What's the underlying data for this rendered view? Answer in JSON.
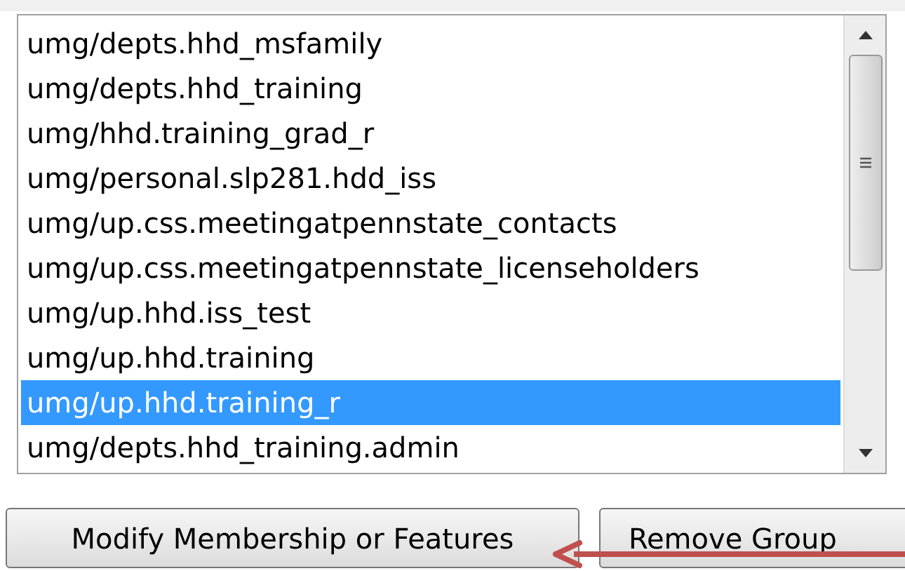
{
  "list": {
    "items": [
      {
        "label": "umg/depts.hhd_msfamily",
        "selected": false
      },
      {
        "label": "umg/depts.hhd_training",
        "selected": false
      },
      {
        "label": "umg/hhd.training_grad_r",
        "selected": false
      },
      {
        "label": "umg/personal.slp281.hdd_iss",
        "selected": false
      },
      {
        "label": "umg/up.css.meetingatpennstate_contacts",
        "selected": false
      },
      {
        "label": "umg/up.css.meetingatpennstate_licenseholders",
        "selected": false
      },
      {
        "label": "umg/up.hhd.iss_test",
        "selected": false
      },
      {
        "label": "umg/up.hhd.training",
        "selected": false
      },
      {
        "label": "umg/up.hhd.training_r",
        "selected": true
      },
      {
        "label": "umg/depts.hhd_training.admin",
        "selected": false
      }
    ]
  },
  "buttons": [
    {
      "label": "Modify Membership or Features"
    },
    {
      "label": "Remove Group"
    }
  ]
}
